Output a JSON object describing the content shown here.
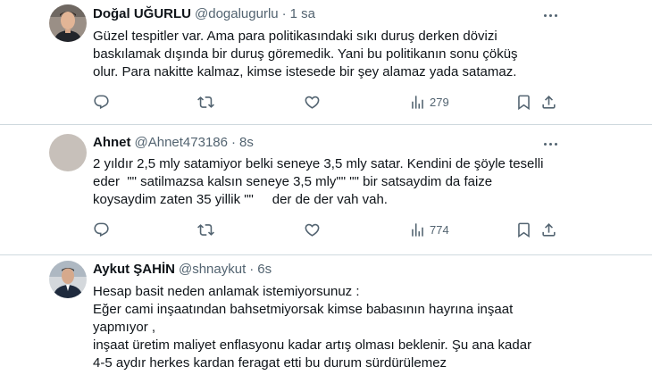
{
  "tweets": [
    {
      "author": "Doğal UĞURLU",
      "handle": "@dogalugurlu",
      "time": "1 sa",
      "separator": "·",
      "text": "Güzel tespitler var. Ama para politikasındaki sıkı duruş derken dövizi\nbaskılamak dışında bir duruş göremedik. Yani bu politikanın sonu çöküş\nolur. Para nakitte kalmaz, kimse istesede bir şey alamaz yada satamaz.",
      "views": "279"
    },
    {
      "author": "Ahnet",
      "handle": "@Ahnet473186",
      "time": "8s",
      "separator": "·",
      "text": "2 yıldır 2,5 mly satamiyor belki seneye 3,5 mly satar. Kendini de şöyle teselli\neder  \"\" satilmazsa kalsın seneye 3,5 mly\"\" \"\" bir satsaydim da faize\nkoysaydim zaten 35 yillik \"\"     der de der vah vah.",
      "views": "774"
    },
    {
      "author": "Aykut ŞAHİN",
      "handle": "@shnaykut",
      "time": "6s",
      "separator": "·",
      "text": "Hesap basit neden anlamak istemiyorsunuz :\nEğer cami inşaatından bahsetmiyorsak kimse babasının hayrına inşaat\nyapmıyor ,\ninşaat üretim maliyet enflasyonu kadar artış olması beklenir. Şu ana kadar\n4-5 aydır herkes kardan feragat etti bu durum sürdürülemez"
    }
  ],
  "icons": {
    "reply": "reply-icon",
    "retweet": "retweet-icon",
    "like": "heart-icon",
    "views": "views-chart-icon",
    "bookmark": "bookmark-icon",
    "share": "share-icon",
    "more": "more-icon"
  },
  "colors": {
    "text": "#0f1419",
    "muted": "#536471",
    "divider": "#cfd9de"
  }
}
